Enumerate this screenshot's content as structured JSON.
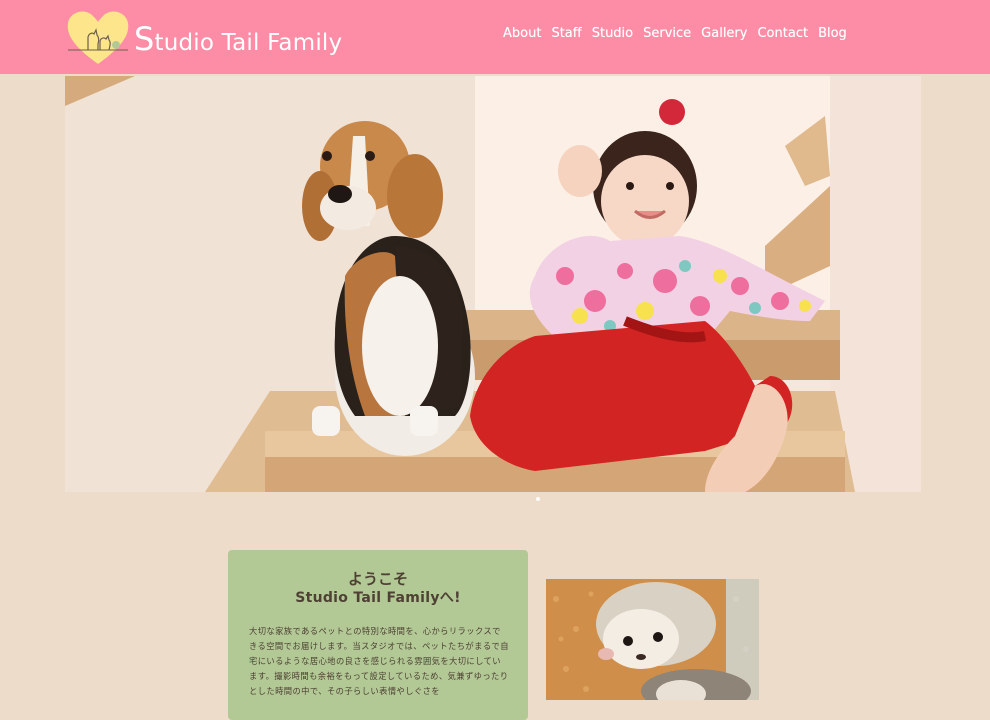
{
  "header": {
    "logo": {
      "text_initial": "S",
      "text_rest": "tudio Tail Family"
    },
    "nav": [
      "About",
      "Staff",
      "Studio",
      "Service",
      "Gallery",
      "Contact",
      "Blog"
    ]
  },
  "hero": {
    "image": "photo of a beagle and a toddler in red hakama sitting on wooden stairs",
    "slides_indicator": "1"
  },
  "welcome": {
    "title_line1": "ようこそ",
    "title_line2": "Studio Tail Familyへ!",
    "body": "大切な家族であるペットとの特別な時間を、心からリラックスできる空間でお届けします。当スタジオでは、ペットたちがまるで自宅にいるような居心地の良さを感じられる雰囲気を大切にしています。撮影時間も余裕をもって設定しているため、気兼ずゆったりとした時間の中で、その子らしい表情やしぐさを"
  },
  "side_image": {
    "alt": "hedgehog photo"
  },
  "colors": {
    "header_bg": "#fd8da6",
    "page_bg": "#ecdcc9",
    "card_bg": "#b2c996",
    "text": "#4e4133",
    "logo_heart": "#fce58b"
  }
}
